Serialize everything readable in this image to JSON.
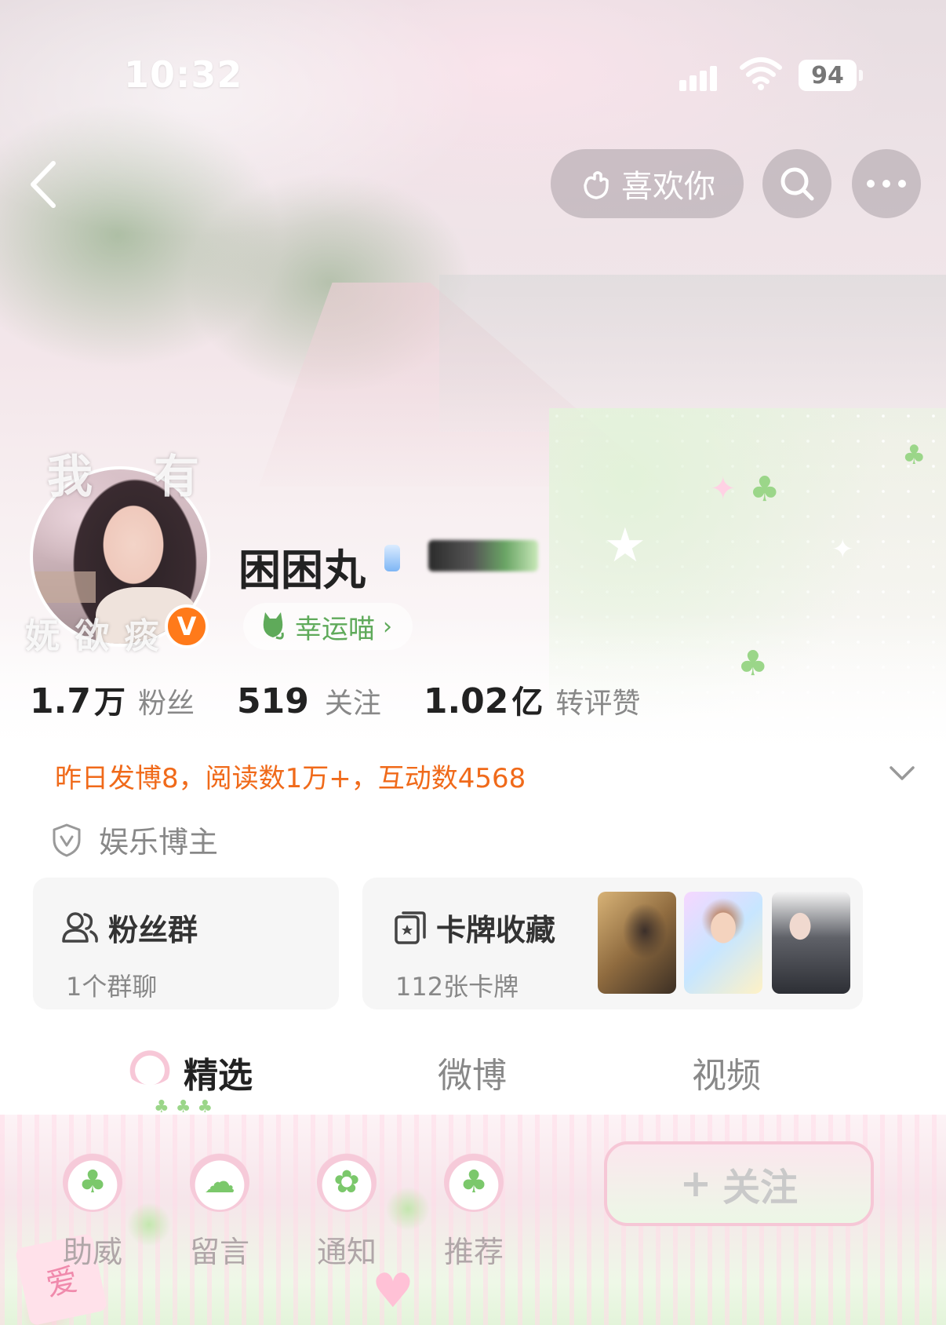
{
  "status_bar": {
    "time": "10:32",
    "battery": "94"
  },
  "nav": {
    "like_label": "喜欢你"
  },
  "avatar_deco": {
    "top_left": "我",
    "top_right": "有",
    "bottom": "妩 欲 痰"
  },
  "profile": {
    "username": "困困丸",
    "verified_badge": "V",
    "lucky_label": "幸运喵",
    "lucky_chevron": "›"
  },
  "stats": [
    {
      "num": "1.7",
      "unit": "万",
      "label": "粉丝"
    },
    {
      "num": "519",
      "unit": "",
      "label": "关注"
    },
    {
      "num": "1.02",
      "unit": "亿",
      "label": "转评赞"
    }
  ],
  "daily_summary": "昨日发博8，阅读数1万+，互动数4568",
  "category": "娱乐博主",
  "cards": {
    "fans_group": {
      "title": "粉丝群",
      "sub": "1个群聊"
    },
    "card_collection": {
      "title": "卡牌收藏",
      "sub": "112张卡牌"
    }
  },
  "tabs": [
    {
      "label": "精选",
      "active": true
    },
    {
      "label": "微博",
      "active": false
    },
    {
      "label": "视频",
      "active": false
    }
  ],
  "bottom_bar": {
    "items": [
      {
        "label": "助威",
        "icon": "clover-icon"
      },
      {
        "label": "留言",
        "icon": "cloud-icon"
      },
      {
        "label": "通知",
        "icon": "cat-icon"
      },
      {
        "label": "推荐",
        "icon": "clover-icon"
      }
    ],
    "follow_label": "关注",
    "follow_plus": "+",
    "tag_text": "爱"
  },
  "colors": {
    "accent_orange": "#f06a1a",
    "lucky_green": "#5faa5a",
    "verified_orange": "#ff7a1a"
  }
}
